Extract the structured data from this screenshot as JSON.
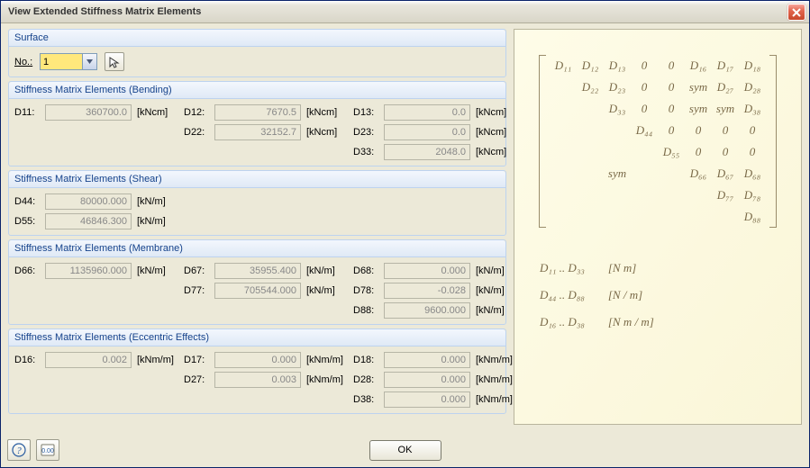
{
  "window": {
    "title": "View Extended Stiffness Matrix Elements"
  },
  "surface": {
    "group_title": "Surface",
    "no_label": "No.:",
    "no_value": "1"
  },
  "bending": {
    "title": "Stiffness Matrix Elements (Bending)",
    "unit": "[kNcm]",
    "d11_label": "D11:",
    "d11": "360700.0",
    "d12_label": "D12:",
    "d12": "7670.5",
    "d13_label": "D13:",
    "d13": "0.0",
    "d22_label": "D22:",
    "d22": "32152.7",
    "d23_label": "D23:",
    "d23": "0.0",
    "d33_label": "D33:",
    "d33": "2048.0"
  },
  "shear": {
    "title": "Stiffness Matrix Elements (Shear)",
    "unit": "[kN/m]",
    "d44_label": "D44:",
    "d44": "80000.000",
    "d55_label": "D55:",
    "d55": "46846.300"
  },
  "membrane": {
    "title": "Stiffness Matrix Elements (Membrane)",
    "unit": "[kN/m]",
    "d66_label": "D66:",
    "d66": "1135960.000",
    "d67_label": "D67:",
    "d67": "35955.400",
    "d68_label": "D68:",
    "d68": "0.000",
    "d77_label": "D77:",
    "d77": "705544.000",
    "d78_label": "D78:",
    "d78": "-0.028",
    "d88_label": "D88:",
    "d88": "9600.000"
  },
  "eccentric": {
    "title": "Stiffness Matrix Elements (Eccentric Effects)",
    "unit": "[kNm/m]",
    "d16_label": "D16:",
    "d16": "0.002",
    "d17_label": "D17:",
    "d17": "0.000",
    "d18_label": "D18:",
    "d18": "0.000",
    "d27_label": "D27:",
    "d27": "0.003",
    "d28_label": "D28:",
    "d28": "0.000",
    "d38_label": "D38:",
    "d38": "0.000"
  },
  "matrix": {
    "cells": [
      "D₁₁",
      "D₁₂",
      "D₁₃",
      "0",
      "0",
      "D₁₆",
      "D₁₇",
      "D₁₈",
      "",
      "D₂₂",
      "D₂₃",
      "0",
      "0",
      "sym",
      "D₂₇",
      "D₂₈",
      "",
      "",
      "D₃₃",
      "0",
      "0",
      "sym",
      "sym",
      "D₃₈",
      "",
      "",
      "",
      "D₄₄",
      "0",
      "0",
      "0",
      "0",
      "",
      "",
      "",
      "",
      "D₅₅",
      "0",
      "0",
      "0",
      "",
      "",
      "sym",
      "",
      "",
      "D₆₆",
      "D₆₇",
      "D₆₈",
      "",
      "",
      "",
      "",
      "",
      "",
      "D₇₇",
      "D₇₈",
      "",
      "",
      "",
      "",
      "",
      "",
      "",
      "D₈₈"
    ]
  },
  "legend": {
    "r1a": "D₁₁ .. D₃₃",
    "r1b": "[N m]",
    "r2a": "D₄₄ .. D₈₈",
    "r2b": "[N / m]",
    "r3a": "D₁₆ .. D₃₈",
    "r3b": "[N m / m]"
  },
  "footer": {
    "ok": "OK"
  }
}
